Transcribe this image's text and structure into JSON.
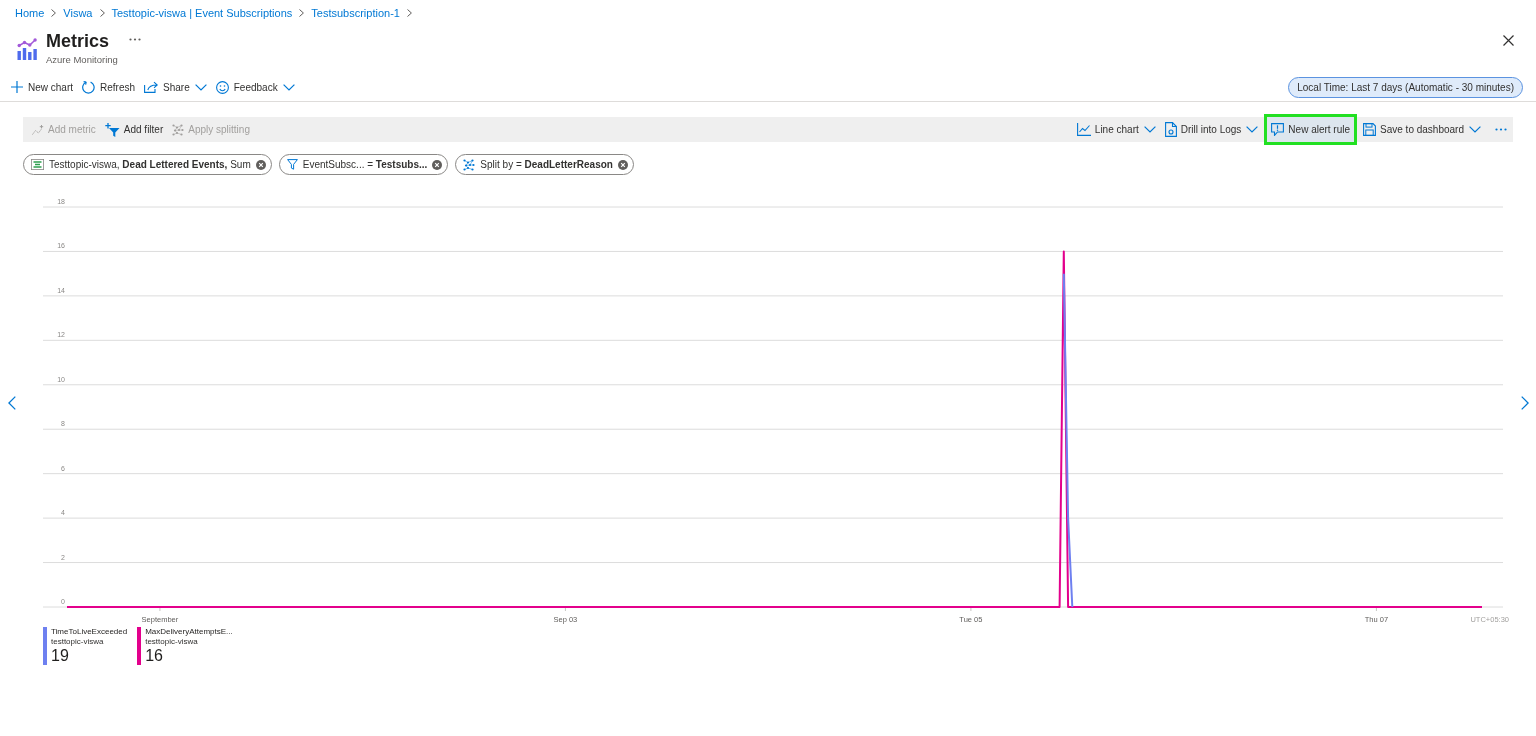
{
  "breadcrumb": [
    {
      "label": "Home"
    },
    {
      "label": "Viswa"
    },
    {
      "label": "Testtopic-viswa | Event Subscriptions"
    },
    {
      "label": "Testsubscription-1"
    }
  ],
  "header": {
    "title": "Metrics",
    "subtitle": "Azure Monitoring"
  },
  "commands": [
    {
      "label": "New chart",
      "dropdown": false
    },
    {
      "label": "Refresh",
      "dropdown": false
    },
    {
      "label": "Share",
      "dropdown": true
    },
    {
      "label": "Feedback",
      "dropdown": true
    }
  ],
  "time_range": {
    "label": "Local Time: Last 7 days (Automatic - 30 minutes)"
  },
  "chart_toolbar": {
    "left": [
      {
        "label": "Add metric",
        "disabled": true
      },
      {
        "label": "Add filter",
        "disabled": false
      },
      {
        "label": "Apply splitting",
        "disabled": true
      }
    ],
    "right": [
      {
        "label": "Line chart",
        "dropdown": true,
        "highlighted": false
      },
      {
        "label": "Drill into Logs",
        "dropdown": true,
        "highlighted": false
      },
      {
        "label": "New alert rule",
        "dropdown": false,
        "highlighted": true
      },
      {
        "label": "Save to dashboard",
        "dropdown": true,
        "highlighted": false
      }
    ]
  },
  "pills": [
    {
      "text": "Testtopic-viswa, **Dead Lettered Events,** Sum"
    },
    {
      "text": "EventSubsc... = **Testsubs...**"
    },
    {
      "text": "Split by = **DeadLetterReason**"
    }
  ],
  "chart": {
    "chart_data": {
      "type": "line",
      "grid": true,
      "categories": [
        null,
        null,
        null,
        null,
        null,
        null,
        null,
        null,
        null,
        null,
        null,
        null,
        null,
        null,
        null,
        null,
        null,
        null,
        null,
        null,
        null,
        null,
        "September",
        null,
        null,
        null,
        null,
        null,
        null,
        null,
        null,
        null,
        null,
        null,
        null,
        null,
        null,
        null,
        null,
        null,
        null,
        null,
        null,
        null,
        null,
        null,
        null,
        null,
        null,
        null,
        null,
        null,
        null,
        null,
        null,
        null,
        null,
        null,
        null,
        null,
        null,
        null,
        null,
        null,
        null,
        null,
        null,
        null,
        null,
        null,
        null,
        null,
        null,
        null,
        null,
        null,
        null,
        null,
        null,
        null,
        null,
        null,
        null,
        null,
        null,
        null,
        null,
        null,
        null,
        null,
        null,
        null,
        null,
        null,
        null,
        null,
        null,
        null,
        null,
        null,
        null,
        null,
        null,
        null,
        null,
        null,
        null,
        null,
        null,
        null,
        null,
        null,
        null,
        null,
        null,
        null,
        null,
        null,
        "Sep 03",
        null,
        null,
        null,
        null,
        null,
        null,
        null,
        null,
        null,
        null,
        null,
        null,
        null,
        null,
        null,
        null,
        null,
        null,
        null,
        null,
        null,
        null,
        null,
        null,
        null,
        null,
        null,
        null,
        null,
        null,
        null,
        null,
        null,
        null,
        null,
        null,
        null,
        null,
        null,
        null,
        null,
        null,
        null,
        null,
        null,
        null,
        null,
        null,
        null,
        null,
        null,
        null,
        null,
        null,
        null,
        null,
        null,
        null,
        null,
        null,
        null,
        null,
        null,
        null,
        null,
        null,
        null,
        null,
        null,
        null,
        null,
        null,
        null,
        null,
        null,
        null,
        null,
        null,
        null,
        null,
        null,
        null,
        null,
        null,
        null,
        null,
        null,
        null,
        null,
        null,
        null,
        null,
        null,
        null,
        null,
        "Tue 05",
        null,
        null,
        null,
        null,
        null,
        null,
        null,
        null,
        null,
        null,
        null,
        null,
        null,
        null,
        null,
        null,
        null,
        null,
        null,
        null,
        null,
        null,
        null,
        null,
        null,
        null,
        null,
        null,
        null,
        null,
        null,
        null,
        null,
        null,
        null,
        null,
        null,
        null,
        null,
        null,
        null,
        null,
        null,
        null,
        null,
        null,
        null,
        null,
        null,
        null,
        null,
        null,
        null,
        null,
        null,
        null,
        null,
        null,
        null,
        null,
        null,
        null,
        null,
        null,
        null,
        null,
        null,
        null,
        null,
        null,
        null,
        null,
        null,
        null,
        null,
        null,
        null,
        null,
        null,
        null,
        null,
        null,
        null,
        null,
        null,
        null,
        null,
        null,
        null,
        null,
        null,
        null,
        null,
        null,
        null,
        "Thu 07",
        null,
        null,
        null,
        null,
        null,
        null,
        null,
        null,
        null,
        null,
        null,
        null,
        null,
        null,
        null,
        null,
        null,
        null,
        null,
        null,
        null,
        null,
        null,
        null,
        null
      ],
      "series": [
        {
          "name": "TimeToLiveExceeded",
          "color": "#6e80f0",
          "values": [
            null,
            null,
            null,
            null,
            null,
            null,
            null,
            null,
            null,
            null,
            null,
            null,
            null,
            null,
            null,
            null,
            null,
            null,
            null,
            null,
            null,
            null,
            null,
            null,
            null,
            null,
            null,
            null,
            null,
            null,
            null,
            null,
            null,
            null,
            null,
            null,
            null,
            null,
            null,
            null,
            null,
            null,
            null,
            null,
            null,
            null,
            null,
            null,
            null,
            null,
            null,
            null,
            null,
            null,
            null,
            null,
            null,
            null,
            null,
            null,
            null,
            null,
            null,
            null,
            null,
            null,
            null,
            null,
            null,
            null,
            null,
            null,
            null,
            null,
            null,
            null,
            null,
            null,
            null,
            null,
            null,
            null,
            null,
            null,
            null,
            null,
            null,
            null,
            null,
            null,
            null,
            null,
            null,
            null,
            null,
            null,
            null,
            null,
            null,
            null,
            null,
            null,
            null,
            null,
            null,
            null,
            null,
            null,
            null,
            null,
            null,
            null,
            null,
            null,
            null,
            null,
            null,
            null,
            null,
            null,
            null,
            null,
            null,
            null,
            null,
            null,
            null,
            null,
            null,
            null,
            null,
            null,
            null,
            null,
            null,
            null,
            null,
            null,
            null,
            null,
            null,
            null,
            null,
            null,
            null,
            null,
            null,
            null,
            null,
            null,
            null,
            null,
            null,
            null,
            null,
            null,
            null,
            null,
            null,
            null,
            null,
            null,
            null,
            null,
            null,
            null,
            null,
            null,
            null,
            null,
            null,
            null,
            null,
            null,
            null,
            null,
            null,
            null,
            null,
            null,
            null,
            null,
            null,
            null,
            null,
            null,
            null,
            null,
            null,
            null,
            null,
            null,
            null,
            null,
            null,
            null,
            null,
            null,
            null,
            null,
            null,
            null,
            null,
            null,
            null,
            null,
            null,
            null,
            null,
            null,
            null,
            null,
            null,
            null,
            null,
            null,
            null,
            null,
            null,
            null,
            null,
            null,
            null,
            null,
            null,
            null,
            null,
            null,
            null,
            null,
            null,
            null,
            null,
            null,
            null,
            null,
            15,
            4,
            0,
            null,
            null,
            null,
            null,
            null,
            null,
            null,
            null,
            null,
            null,
            null,
            null,
            null,
            null,
            null,
            null,
            null,
            null,
            null,
            null,
            null,
            null,
            null,
            null,
            null,
            null,
            null,
            null,
            null,
            null,
            null,
            null,
            null,
            null,
            null,
            null,
            null,
            null,
            null,
            null,
            null,
            null,
            null,
            null,
            null,
            null,
            null,
            null,
            null,
            null,
            null,
            null,
            null,
            null,
            null,
            null,
            null,
            null,
            null,
            null,
            null,
            null,
            null,
            null,
            null,
            null,
            null,
            null,
            null,
            null,
            null,
            null,
            null,
            null,
            null,
            null,
            null,
            null,
            null,
            null,
            null,
            null,
            null,
            null,
            null,
            null,
            null,
            null,
            null,
            null,
            null,
            null,
            null,
            null,
            null,
            null,
            null
          ]
        },
        {
          "name": "MaxDeliveryAttemptsE...",
          "color": "#e3008c",
          "values": [
            0,
            0,
            0,
            0,
            0,
            0,
            0,
            0,
            0,
            0,
            0,
            0,
            0,
            0,
            0,
            0,
            0,
            0,
            0,
            0,
            0,
            0,
            0,
            0,
            0,
            0,
            0,
            0,
            0,
            0,
            0,
            0,
            0,
            0,
            0,
            0,
            0,
            0,
            0,
            0,
            0,
            0,
            0,
            0,
            0,
            0,
            0,
            0,
            0,
            0,
            0,
            0,
            0,
            0,
            0,
            0,
            0,
            0,
            0,
            0,
            0,
            0,
            0,
            0,
            0,
            0,
            0,
            0,
            0,
            0,
            0,
            0,
            0,
            0,
            0,
            0,
            0,
            0,
            0,
            0,
            0,
            0,
            0,
            0,
            0,
            0,
            0,
            0,
            0,
            0,
            0,
            0,
            0,
            0,
            0,
            0,
            0,
            0,
            0,
            0,
            0,
            0,
            0,
            0,
            0,
            0,
            0,
            0,
            0,
            0,
            0,
            0,
            0,
            0,
            0,
            0,
            0,
            0,
            0,
            0,
            0,
            0,
            0,
            0,
            0,
            0,
            0,
            0,
            0,
            0,
            0,
            0,
            0,
            0,
            0,
            0,
            0,
            0,
            0,
            0,
            0,
            0,
            0,
            0,
            0,
            0,
            0,
            0,
            0,
            0,
            0,
            0,
            0,
            0,
            0,
            0,
            0,
            0,
            0,
            0,
            0,
            0,
            0,
            0,
            0,
            0,
            0,
            0,
            0,
            0,
            0,
            0,
            0,
            0,
            0,
            0,
            0,
            0,
            0,
            0,
            0,
            0,
            0,
            0,
            0,
            0,
            0,
            0,
            0,
            0,
            0,
            0,
            0,
            0,
            0,
            0,
            0,
            0,
            0,
            0,
            0,
            0,
            0,
            0,
            0,
            0,
            0,
            0,
            0,
            0,
            0,
            0,
            0,
            0,
            0,
            0,
            0,
            0,
            0,
            0,
            0,
            0,
            0,
            0,
            0,
            0,
            0,
            0,
            0,
            0,
            0,
            0,
            0,
            0,
            0,
            0,
            16,
            0,
            0,
            0,
            0,
            0,
            0,
            0,
            0,
            0,
            0,
            0,
            0,
            0,
            0,
            0,
            0,
            0,
            0,
            0,
            0,
            0,
            0,
            0,
            0,
            0,
            0,
            0,
            0,
            0,
            0,
            0,
            0,
            0,
            0,
            0,
            0,
            0,
            0,
            0,
            0,
            0,
            0,
            0,
            0,
            0,
            0,
            0,
            0,
            0,
            0,
            0,
            0,
            0,
            0,
            0,
            0,
            0,
            0,
            0,
            0,
            0,
            0,
            0,
            0,
            0,
            0,
            0,
            0,
            0,
            0,
            0,
            0,
            0,
            0,
            0,
            0,
            0,
            0,
            0,
            0,
            0,
            0,
            0,
            0,
            0,
            0,
            0,
            0,
            0,
            0,
            0,
            0,
            0,
            0,
            0,
            0,
            0,
            0,
            0
          ]
        }
      ],
      "ylim": [
        0,
        18
      ],
      "yticks": [
        0,
        2,
        4,
        6,
        8,
        10,
        12,
        14,
        16,
        18
      ]
    },
    "timezone": "UTC+05:30",
    "legend": [
      {
        "source": "testtopic-viswa",
        "value": "19"
      },
      {
        "source": "testtopic-viswa",
        "value": "16"
      }
    ]
  }
}
